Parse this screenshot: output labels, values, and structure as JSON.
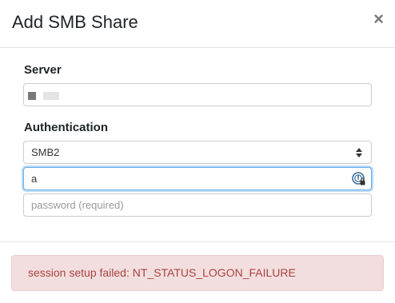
{
  "dialog": {
    "title": "Add SMB Share",
    "close_label": "×"
  },
  "server": {
    "label": "Server"
  },
  "authentication": {
    "label": "Authentication",
    "protocol_selected": "SMB2",
    "username_value": "a",
    "password_placeholder": "password (required)"
  },
  "alert": {
    "message": "session setup failed: NT_STATUS_LOGON_FAILURE"
  },
  "icons": {
    "close": "close-icon",
    "select": "chevron-updown-icon",
    "password_manager": "password-manager-icon"
  },
  "colors": {
    "alert_bg": "#f2dede",
    "alert_text": "#a94442",
    "focus_border": "#66afe9"
  }
}
